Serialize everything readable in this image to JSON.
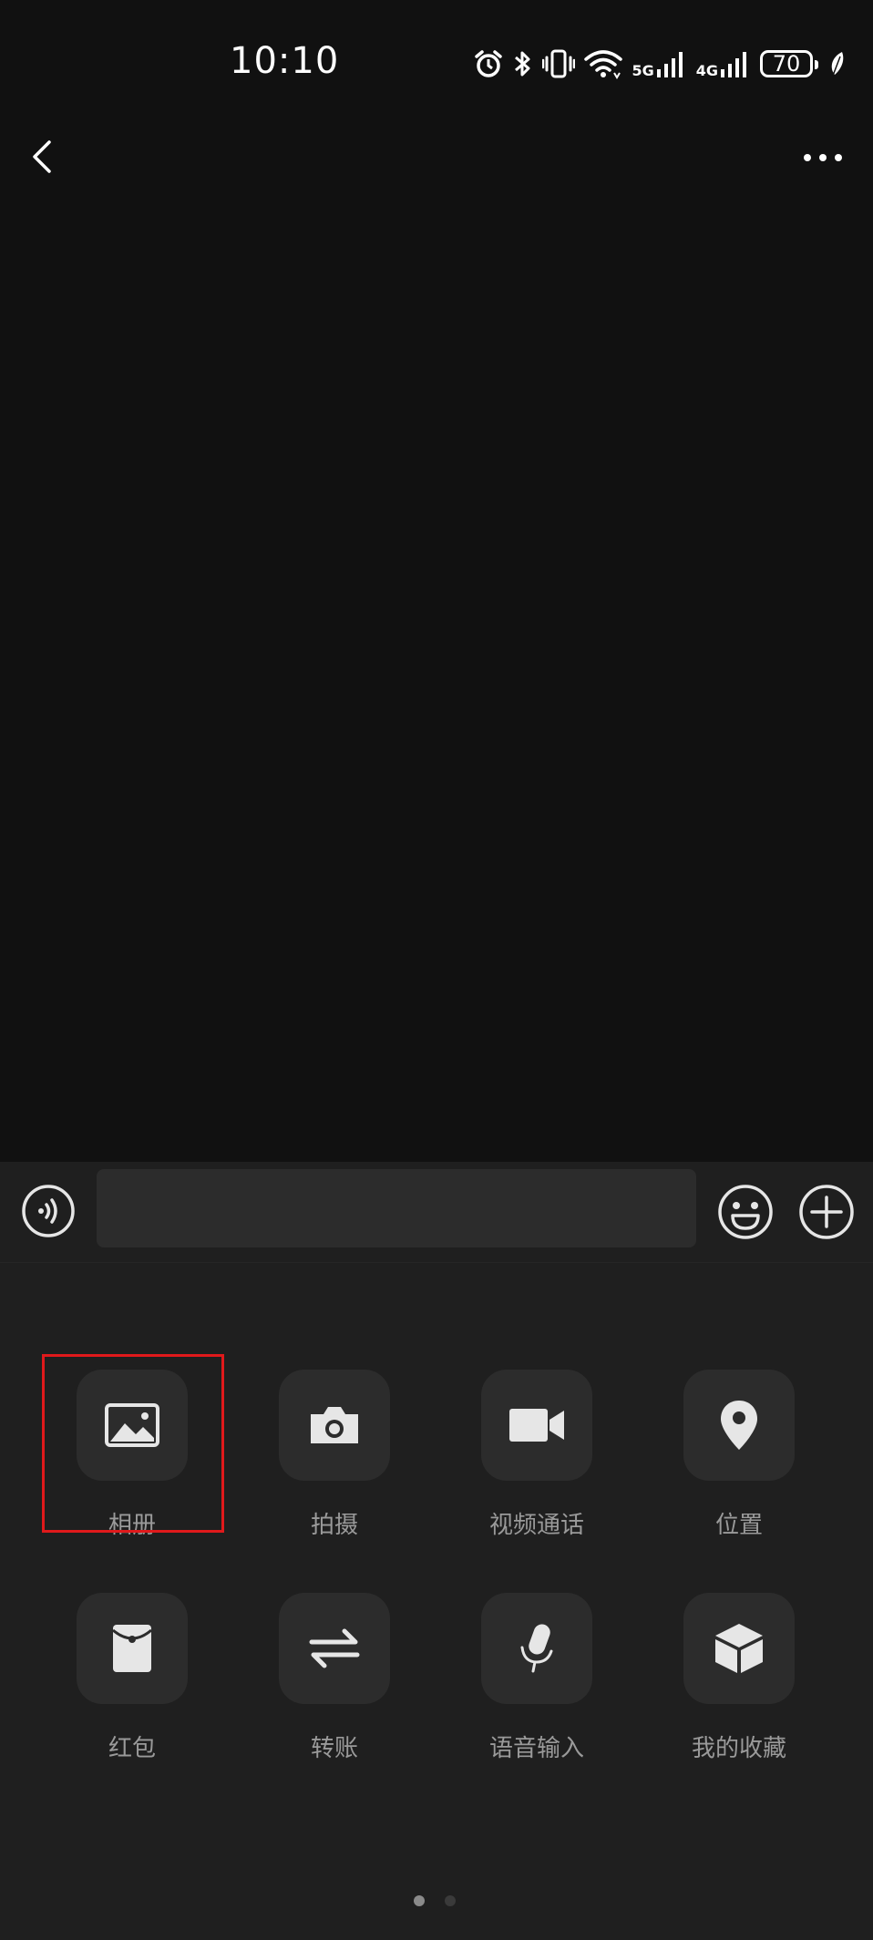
{
  "status_bar": {
    "time": "10:10",
    "network_5g": "5G",
    "network_4g": "4G",
    "battery": "70"
  },
  "nav": {
    "back_icon": "chevron-left-icon",
    "more_icon": "more-horizontal-icon"
  },
  "input_bar": {
    "message_value": "",
    "voice_icon": "voice-icon",
    "emoji_icon": "emoji-icon",
    "plus_icon": "plus-circle-icon"
  },
  "panel": {
    "row1": [
      {
        "label": "相册",
        "icon": "photo-album-icon"
      },
      {
        "label": "拍摄",
        "icon": "camera-icon"
      },
      {
        "label": "视频通话",
        "icon": "video-call-icon"
      },
      {
        "label": "位置",
        "icon": "location-pin-icon"
      }
    ],
    "row2": [
      {
        "label": "红包",
        "icon": "red-packet-icon"
      },
      {
        "label": "转账",
        "icon": "transfer-icon"
      },
      {
        "label": "语音输入",
        "icon": "microphone-icon"
      },
      {
        "label": "我的收藏",
        "icon": "favorites-box-icon"
      }
    ],
    "highlight_color": "#e0191b",
    "page_count": 2,
    "current_page": 1
  },
  "colors": {
    "background": "#111111",
    "panel": "#1f1f1f",
    "tile": "#2c2c2c",
    "label": "#9a9a9a",
    "icon": "#e6e6e6"
  }
}
